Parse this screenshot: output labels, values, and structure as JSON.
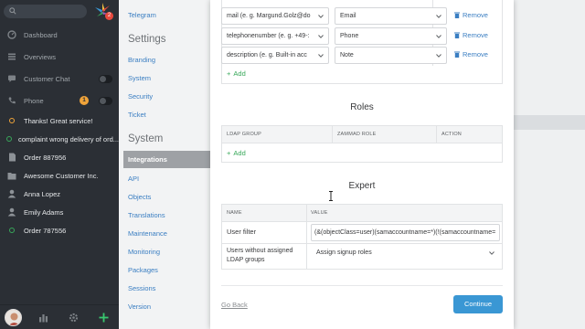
{
  "sidebar": {
    "search_placeholder": "",
    "logo_badge": "2",
    "items": [
      {
        "label": "Dashboard",
        "icon": "dashboard-icon"
      },
      {
        "label": "Overviews",
        "icon": "overviews-icon"
      },
      {
        "label": "Customer Chat",
        "icon": "chat-icon"
      },
      {
        "label": "Phone",
        "icon": "phone-icon",
        "badge": "1"
      },
      {
        "label": "Thanks! Great service!",
        "icon": "ticket-status-icon"
      },
      {
        "label": "complaint wrong delivery of ord...",
        "icon": "ticket-status-icon"
      },
      {
        "label": "Order 887956",
        "icon": "document-icon"
      },
      {
        "label": "Awesome Customer Inc.",
        "icon": "organization-icon"
      },
      {
        "label": "Anna Lopez",
        "icon": "user-icon"
      },
      {
        "label": "Emily Adams",
        "icon": "user-icon"
      },
      {
        "label": "Order 787556",
        "icon": "ticket-status-icon"
      }
    ]
  },
  "settings_nav": {
    "top_item": "Telegram",
    "settings_head": "Settings",
    "settings_items": [
      "Branding",
      "System",
      "Security",
      "Ticket"
    ],
    "system_head": "System",
    "system_items": [
      "Integrations",
      "API",
      "Objects",
      "Translations",
      "Maintenance",
      "Monitoring",
      "Packages",
      "Sessions",
      "Version"
    ]
  },
  "mapping": {
    "rows": [
      {
        "ldap": "mail (e. g. Margund.Golz@do",
        "zammad": "Email",
        "remove": "Remove"
      },
      {
        "ldap": "telephonenumber (e. g. +49-:",
        "zammad": "Phone",
        "remove": "Remove"
      },
      {
        "ldap": "description (e. g. Built-in acc",
        "zammad": "Note",
        "remove": "Remove"
      }
    ],
    "add": "Add"
  },
  "roles": {
    "title": "Roles",
    "headers": [
      "LDAP GROUP",
      "ZAMMAD ROLE",
      "ACTION"
    ],
    "add": "Add"
  },
  "expert": {
    "title": "Expert",
    "headers": [
      "NAME",
      "VALUE"
    ],
    "user_filter_label": "User filter",
    "user_filter_value": "(&(objectClass=user)(samaccountname=*)(!(samaccountname=",
    "unassigned_label": "Users without assigned LDAP groups",
    "unassigned_value": "Assign signup roles"
  },
  "footer": {
    "go_back": "Go Back",
    "continue": "Continue"
  },
  "colors": {
    "sidebar_bg": "#2b2f35",
    "link": "#3a7ec2",
    "add_green": "#38a85a",
    "primary_button": "#3a97d4",
    "badge_orange": "#f0a43a",
    "badge_red": "#e8493e"
  }
}
